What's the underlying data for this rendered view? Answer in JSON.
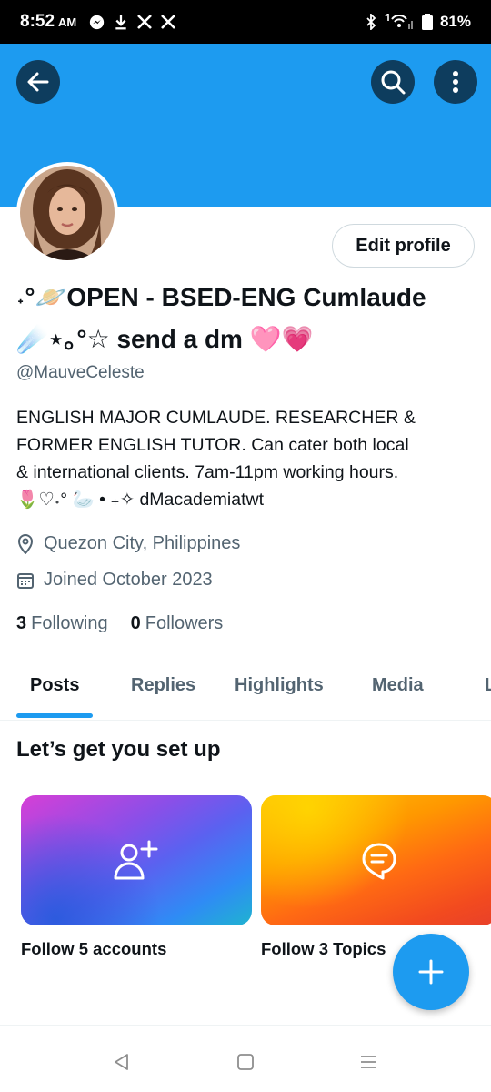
{
  "status_bar": {
    "time": "8:52",
    "ampm": "AM",
    "battery": "81%"
  },
  "header": {
    "back_icon": "arrow-left-icon",
    "search_icon": "search-icon",
    "more_icon": "more-vertical-icon",
    "banner_color": "#1d9bf0"
  },
  "profile": {
    "edit_button": "Edit profile",
    "display_name_line1": "˖°🪐OPEN - BSED-ENG Cumlaude",
    "display_name_line2": "☄️⋆｡°☆ send a dm 🩷💗",
    "handle": "@MauveCeleste",
    "bio_line1": "ENGLISH MAJOR CUMLAUDE. RESEARCHER &",
    "bio_line2": "FORMER ENGLISH TUTOR. Can cater both local",
    "bio_line3": "& international clients. 7am-11pm working hours.",
    "bio_line4": "🌷♡˖° 🦢 • ₊✧  dMacademiatwt",
    "location": "Quezon City, Philippines",
    "joined": "Joined October 2023",
    "following_count": "3",
    "following_label": "Following",
    "followers_count": "0",
    "followers_label": "Followers"
  },
  "tabs": [
    {
      "label": "Posts",
      "active": true
    },
    {
      "label": "Replies",
      "active": false
    },
    {
      "label": "Highlights",
      "active": false
    },
    {
      "label": "Media",
      "active": false
    },
    {
      "label": "L",
      "active": false
    }
  ],
  "setup": {
    "title": "Let’s get you set up",
    "cards": [
      {
        "label": "Follow 5 accounts",
        "icon": "add-user-icon"
      },
      {
        "label": "Follow 3 Topics",
        "icon": "topic-bubble-icon"
      }
    ]
  },
  "fab": {
    "icon": "plus-icon",
    "color": "#1d9bf0"
  },
  "nav_bar": {
    "back": "nav-back-icon",
    "home": "nav-home-icon",
    "recents": "nav-recents-icon"
  }
}
